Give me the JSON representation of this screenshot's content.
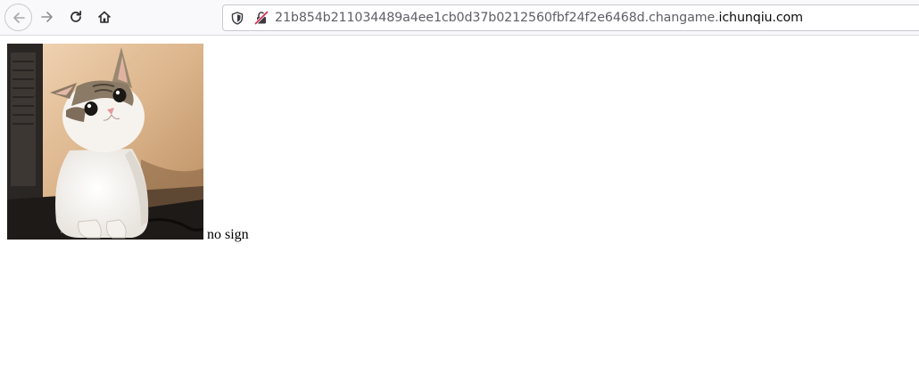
{
  "browser": {
    "nav": {
      "back_icon": "back-arrow-icon",
      "forward_icon": "forward-arrow-icon",
      "reload_icon": "reload-icon",
      "home_icon": "home-icon"
    },
    "address_bar": {
      "tracking_icon": "shield-icon",
      "security_icon": "insecure-lock-icon",
      "url_subdomain": "21b854b211034489a4ee1cb0d37b0212560fbf24f2e6468d.changame.",
      "url_domain": "ichunqiu.com"
    }
  },
  "page": {
    "image": {
      "subject": "cat"
    },
    "text": "no sign"
  },
  "colors": {
    "toolbar_bg": "#f9f9fb",
    "url_dim": "#5f5f66",
    "url_strong": "#0c0c0d",
    "insecure_lock": "#d7264f"
  }
}
